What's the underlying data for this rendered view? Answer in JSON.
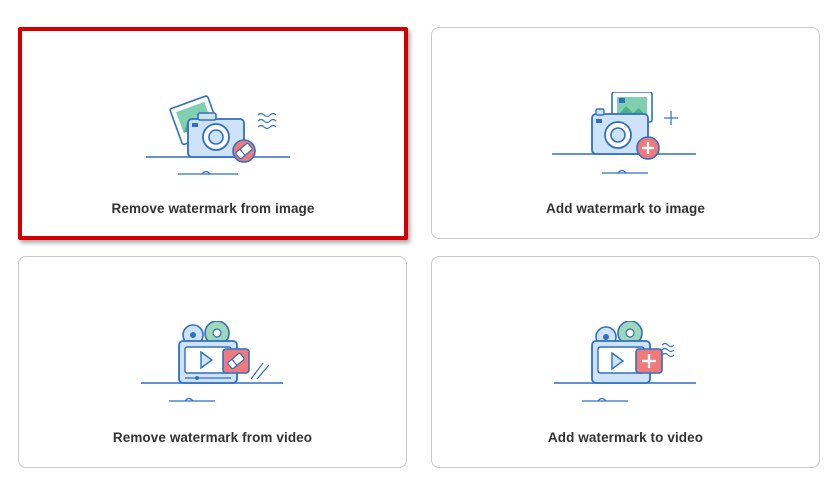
{
  "options": [
    {
      "label": "Remove watermark from image",
      "icon": "camera-eraser-icon",
      "selected": true
    },
    {
      "label": "Add watermark to image",
      "icon": "camera-add-icon",
      "selected": false
    },
    {
      "label": "Remove watermark from video",
      "icon": "video-eraser-icon",
      "selected": false
    },
    {
      "label": "Add watermark to video",
      "icon": "video-add-icon",
      "selected": false
    }
  ],
  "colors": {
    "accent_blue": "#2f6fc4",
    "fill_blue": "#cfe3f8",
    "badge_red": "#f07a7a",
    "selection_border": "#d40000"
  }
}
